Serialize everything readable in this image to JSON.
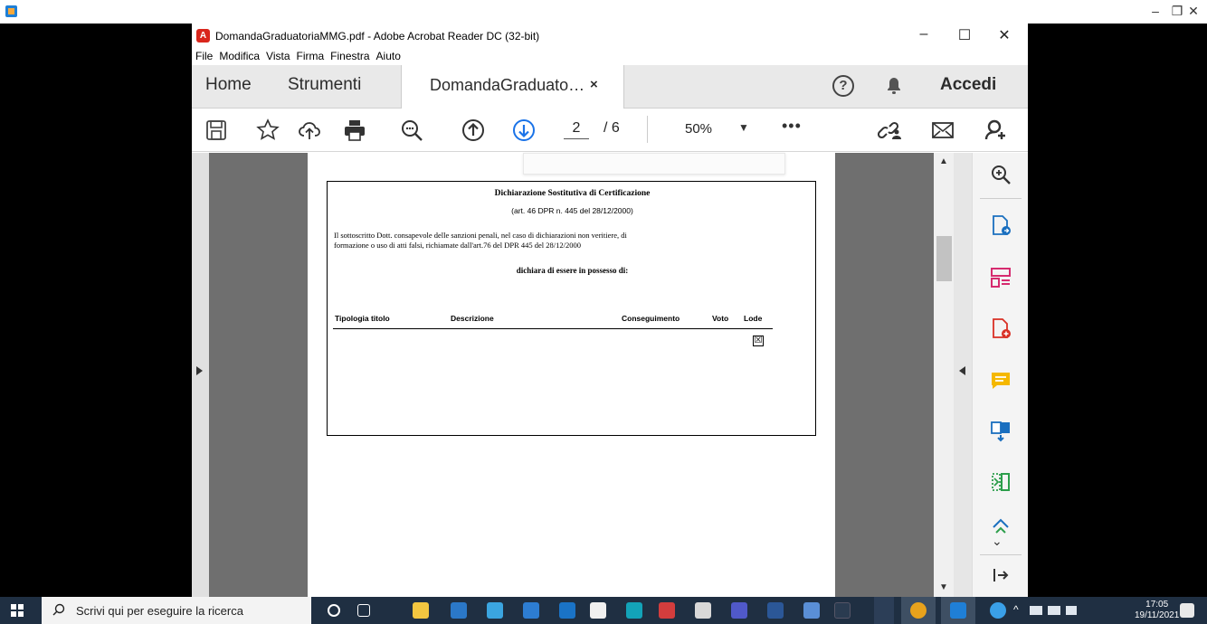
{
  "outer_window": {
    "controls": [
      "–",
      "❐",
      "✕"
    ]
  },
  "window": {
    "title": "DomandaGraduatoriaMMG.pdf - Adobe Acrobat Reader DC (32-bit)",
    "controls": [
      "–",
      "☐",
      "✕"
    ]
  },
  "menu": [
    "File",
    "Modifica",
    "Vista",
    "Firma",
    "Finestra",
    "Aiuto"
  ],
  "tabs": {
    "home": "Home",
    "tools": "Strumenti",
    "doc": "DomandaGraduato…",
    "doc_close": "×",
    "signin": "Accedi"
  },
  "toolbar": {
    "page_current": "2",
    "page_total": "/ 6",
    "zoom": "50%",
    "more": "•••"
  },
  "document": {
    "title": "Dichiarazione Sostitutiva di Certificazione",
    "subtitle": "(art. 46 DPR n. 445 del 28/12/2000)",
    "body_line1": "Il sottoscritto Dott.     consapevole delle sanzioni penali, nel caso di dichiarazioni non veritiere, di",
    "body_line2": "formazione o uso di atti falsi, richiamate dall'art.76 del DPR 445 del 28/12/2000",
    "declaration": "dichiara di essere in possesso di:",
    "columns": [
      "Tipologia titolo",
      "Descrizione",
      "Conseguimento",
      "Voto",
      "Lode"
    ],
    "lode_checked": "☒"
  },
  "taskbar": {
    "search_placeholder": "Scrivi qui per eseguire la ricerca",
    "time": "17:05",
    "date": "19/11/2021"
  }
}
